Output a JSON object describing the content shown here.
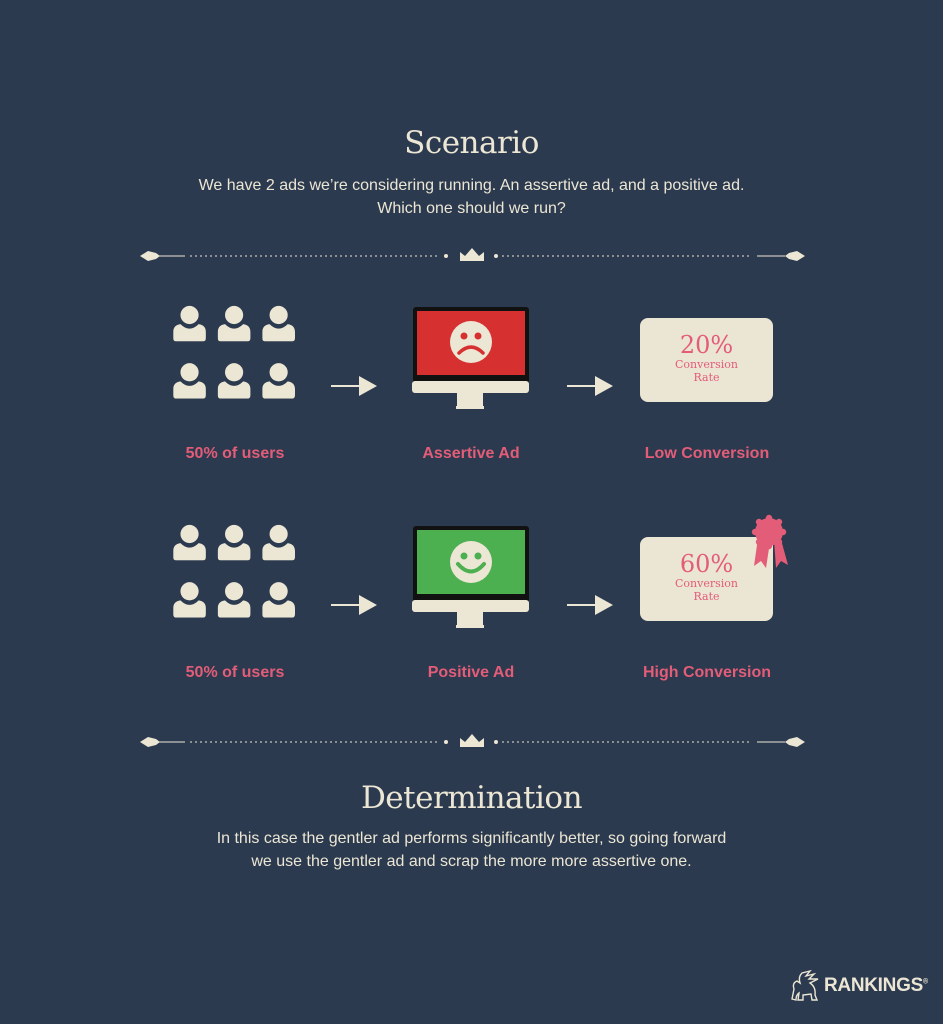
{
  "header": {
    "title": "Scenario",
    "subtitle_line1": "We have 2 ads we’re considering running. An assertive ad, and a positive ad.",
    "subtitle_line2": "Which one should we run?"
  },
  "colors": {
    "background": "#2b3a4e",
    "cream": "#ece6d5",
    "accent_pink": "#e35d79",
    "assertive_screen": "#d63031",
    "positive_screen": "#4caf50"
  },
  "rows": [
    {
      "audience_label": "50% of users",
      "ad_label": "Assertive Ad",
      "ad_icon": "sad-face-icon",
      "result_label": "Low Conversion",
      "conversion_value": "20%",
      "conversion_caption_1": "Conversion",
      "conversion_caption_2": "Rate",
      "award_badge": false
    },
    {
      "audience_label": "50% of users",
      "ad_label": "Positive Ad",
      "ad_icon": "happy-face-icon",
      "result_label": "High Conversion",
      "conversion_value": "60%",
      "conversion_caption_1": "Conversion",
      "conversion_caption_2": "Rate",
      "award_badge": true
    }
  ],
  "footer": {
    "title": "Determination",
    "text_line1": "In this case the gentler ad performs significantly better, so going forward",
    "text_line2": "we use the gentler ad and scrap the more more assertive one."
  },
  "brand": {
    "name": "RANKINGS",
    "mark": "®"
  }
}
